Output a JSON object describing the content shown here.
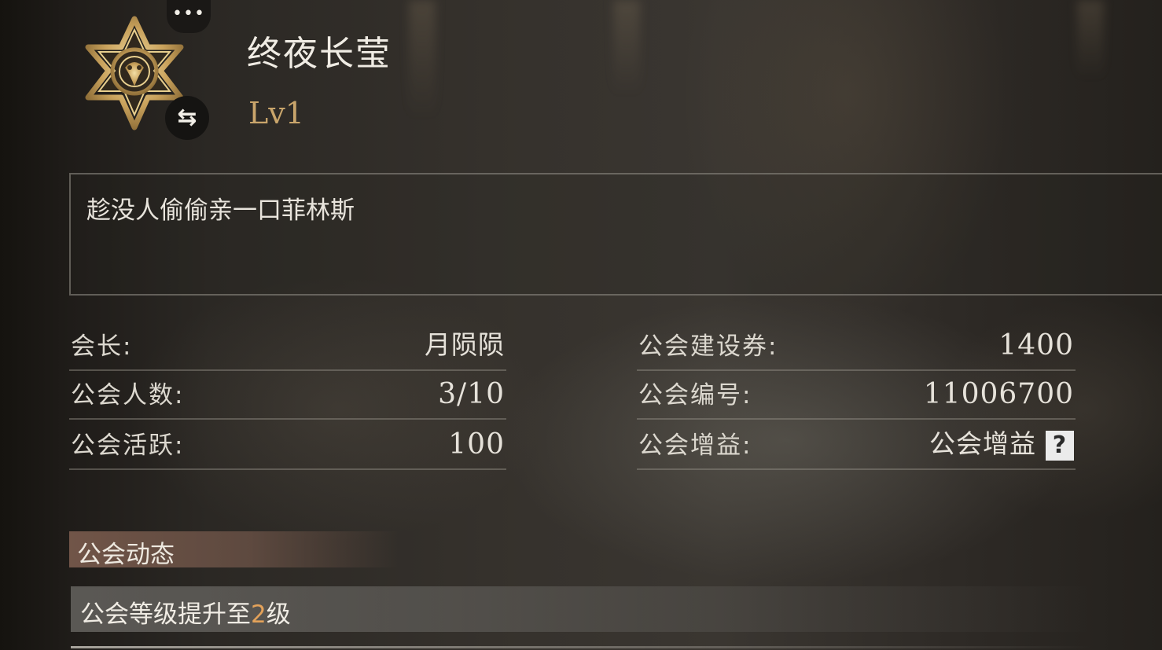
{
  "guild": {
    "name": "终夜长莹",
    "level": "Lv1",
    "notice": "趁没人偷偷亲一口菲林斯"
  },
  "info": {
    "leader_label": "会长:",
    "leader_value": "月陨陨",
    "members_label": "公会人数:",
    "members_value": "3/10",
    "activity_label": "公会活跃:",
    "activity_value": "100",
    "build_coupon_label": "公会建设券:",
    "build_coupon_value": "1400",
    "guild_id_label": "公会编号:",
    "guild_id_value": "11006700",
    "buff_label": "公会增益:",
    "buff_value": "公会增益",
    "help_glyph": "?"
  },
  "buttons": {
    "more_glyph": "•••",
    "swap_glyph": "⇆"
  },
  "news": {
    "title": "公会动态",
    "event_prefix": "公会等级提升至",
    "event_level": "2",
    "event_suffix": "级"
  },
  "colors": {
    "level_gold": "#c9a56b",
    "highlight_orange": "#e3a25a",
    "emblem_gold": "#d8bd7c"
  },
  "icons": {
    "emblem": "guild-emblem-star-icon",
    "more": "more-dots-icon",
    "swap": "swap-arrows-icon",
    "help": "question-mark-icon"
  }
}
